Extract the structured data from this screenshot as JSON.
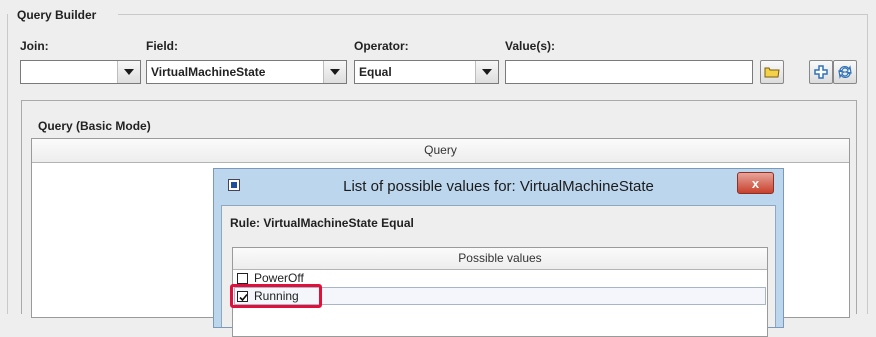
{
  "query_builder": {
    "title": "Query Builder",
    "labels": {
      "join": "Join:",
      "field": "Field:",
      "operator": "Operator:",
      "values": "Value(s):"
    },
    "join_value": "",
    "field_value": "VirtualMachineState",
    "operator_value": "Equal",
    "values_input": ""
  },
  "query_panel": {
    "title": "Query (Basic Mode)",
    "column_header": "Query"
  },
  "dialog": {
    "title": "List of possible values for: VirtualMachineState",
    "close_label": "x",
    "rule": "Rule: VirtualMachineState Equal",
    "column_header": "Possible values",
    "items": [
      {
        "label": "PowerOff",
        "checked": false
      },
      {
        "label": "Running",
        "checked": true
      }
    ]
  },
  "colors": {
    "dialog_title_bg": "#bcd6ee",
    "highlight": "#e0103a",
    "close_button": "#c8412d"
  }
}
